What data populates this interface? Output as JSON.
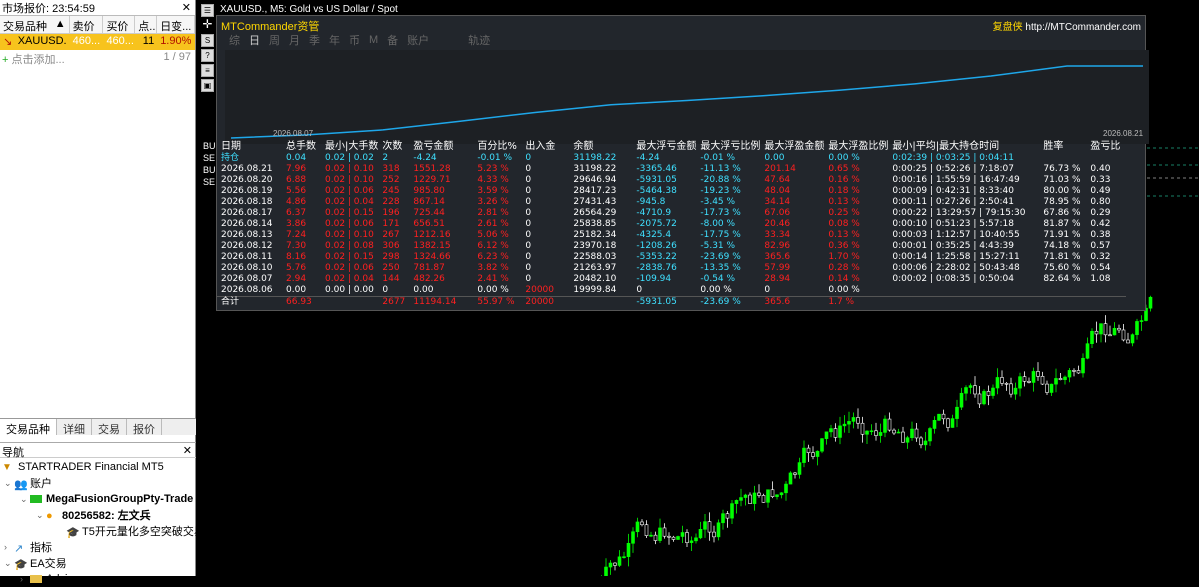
{
  "market_watch": {
    "title": "市场报价: 23:54:59",
    "columns": [
      "交易品种",
      "卖价",
      "买价",
      "点...",
      "日变..."
    ],
    "rows": [
      {
        "symbol": "XAUUSD.",
        "bid": "460...",
        "ask": "460...",
        "spread": "11",
        "change": "1.90%"
      }
    ],
    "add_label": "点击添加...",
    "count": "1 / 97",
    "tabs": [
      "交易品种",
      "详细",
      "交易",
      "报价"
    ]
  },
  "navigator": {
    "title": "导航",
    "items": [
      {
        "label": "STARTRADER Financial MT5",
        "level": 0
      },
      {
        "label": "账户",
        "level": 1
      },
      {
        "label": "MegaFusionGroupPty-Trade",
        "level": 2,
        "bold": true
      },
      {
        "label": "80256582: 左文兵",
        "level": 3,
        "bold": true
      },
      {
        "label": "T5开元量化多空突破交易系统",
        "level": 4
      },
      {
        "label": "指标",
        "level": 1
      },
      {
        "label": "EA交易",
        "level": 1
      },
      {
        "label": "Advisors",
        "level": 2
      }
    ]
  },
  "chart": {
    "title": "XAUUSD., M5:  Gold vs US Dollar / Spot",
    "colors": {
      "bull": "#00ff00",
      "bear": "#ffffff",
      "bg": "#000000"
    }
  },
  "toolbar_icons": [
    "menu-icon",
    "crosshair-icon",
    "script-icon",
    "info-icon",
    "list-icon",
    "save-icon"
  ],
  "buy_sell": [
    "BU",
    "SE",
    "BU",
    "SE"
  ],
  "mtc": {
    "title": "MTCommander资管",
    "brand": "复盘侠",
    "url": "http://MTCommander.com",
    "tabs": [
      "综",
      "日",
      "周",
      "月",
      "季",
      "年",
      "币",
      "M",
      "备",
      "账户",
      "轨迹"
    ],
    "active_tab": "日",
    "curve_start": "2026.08.07",
    "curve_end": "2026.08.21",
    "headers": [
      "日期",
      "总手数",
      "最小|大手数",
      "次数",
      "盈亏金额",
      "百分比%",
      "出入金",
      "余额",
      "最大浮亏金额",
      "最大浮亏比例",
      "最大浮盈金额",
      "最大浮盈比例",
      "最小|平均|最大持仓时间",
      "胜率",
      "盈亏比"
    ],
    "hold": [
      "持仓",
      "0.04",
      "0.02 | 0.02",
      "2",
      "-4.24",
      "-0.01 %",
      "0",
      "31198.22",
      "-4.24",
      "-0.01 %",
      "0.00",
      "0.00 %",
      "0:02:39 | 0:03:25 | 0:04:11",
      "",
      ""
    ],
    "rows": [
      [
        "2026.08.21",
        "7.96",
        "0.02 | 0.10",
        "318",
        "1551.28",
        "5.23 %",
        "0",
        "31198.22",
        "-3365.46",
        "-11.13 %",
        "201.14",
        "0.65 %",
        "0:00:25 | 0:52:26 | 7:18:07",
        "76.73 %",
        "0.40"
      ],
      [
        "2026.08.20",
        "6.88",
        "0.02 | 0.10",
        "252",
        "1229.71",
        "4.33 %",
        "0",
        "29646.94",
        "-5931.05",
        "-20.88 %",
        "47.64",
        "0.16 %",
        "0:00:16 | 1:55:59 | 16:47:49",
        "71.03 %",
        "0.33"
      ],
      [
        "2026.08.19",
        "5.56",
        "0.02 | 0.06",
        "245",
        "985.80",
        "3.59 %",
        "0",
        "28417.23",
        "-5464.38",
        "-19.23 %",
        "48.04",
        "0.18 %",
        "0:00:09 | 0:42:31 | 8:33:40",
        "80.00 %",
        "0.49"
      ],
      [
        "2026.08.18",
        "4.86",
        "0.02 | 0.04",
        "228",
        "867.14",
        "3.26 %",
        "0",
        "27431.43",
        "-945.8",
        "-3.45 %",
        "34.14",
        "0.13 %",
        "0:00:11 | 0:27:26 | 2:50:41",
        "78.95 %",
        "0.80"
      ],
      [
        "2026.08.17",
        "6.37",
        "0.02 | 0.15",
        "196",
        "725.44",
        "2.81 %",
        "0",
        "26564.29",
        "-4710.9",
        "-17.73 %",
        "67.06",
        "0.25 %",
        "0:00:22 | 13:29:57 | 79:15:30",
        "67.86 %",
        "0.29"
      ],
      [
        "2026.08.14",
        "3.86",
        "0.02 | 0.06",
        "171",
        "656.51",
        "2.61 %",
        "0",
        "25838.85",
        "-2075.72",
        "-8.00 %",
        "20.46",
        "0.08 %",
        "0:00:10 | 0:51:23 | 5:57:18",
        "81.87 %",
        "0.42"
      ],
      [
        "2026.08.13",
        "7.24",
        "0.02 | 0.10",
        "267",
        "1212.16",
        "5.06 %",
        "0",
        "25182.34",
        "-4325.4",
        "-17.75 %",
        "33.34",
        "0.13 %",
        "0:00:03 | 1:12:57 | 10:40:55",
        "71.91 %",
        "0.38"
      ],
      [
        "2026.08.12",
        "7.30",
        "0.02 | 0.08",
        "306",
        "1382.15",
        "6.12 %",
        "0",
        "23970.18",
        "-1208.26",
        "-5.31 %",
        "82.96",
        "0.36 %",
        "0:00:01 | 0:35:25 | 4:43:39",
        "74.18 %",
        "0.57"
      ],
      [
        "2026.08.11",
        "8.16",
        "0.02 | 0.15",
        "298",
        "1324.66",
        "6.23 %",
        "0",
        "22588.03",
        "-5353.22",
        "-23.69 %",
        "365.6",
        "1.70 %",
        "0:00:14 | 1:25:58 | 15:27:11",
        "71.81 %",
        "0.32"
      ],
      [
        "2026.08.10",
        "5.76",
        "0.02 | 0.06",
        "250",
        "781.87",
        "3.82 %",
        "0",
        "21263.97",
        "-2838.76",
        "-13.35 %",
        "57.99",
        "0.28 %",
        "0:00:06 | 2:28:02 | 50:43:48",
        "75.60 %",
        "0.54"
      ],
      [
        "2026.08.07",
        "2.94",
        "0.02 | 0.04",
        "144",
        "482.26",
        "2.41 %",
        "0",
        "20482.10",
        "-109.94",
        "-0.54 %",
        "28.94",
        "0.14 %",
        "0:00:02 | 0:08:35 | 0:50:04",
        "82.64 %",
        "1.08"
      ],
      [
        "2026.08.06",
        "0.00",
        "0.00 | 0.00",
        "0",
        "0.00",
        "0.00 %",
        "20000",
        "19999.84",
        "0",
        "0.00 %",
        "0",
        "0.00 %",
        "",
        "",
        ""
      ]
    ],
    "total": [
      "合计",
      "66.93",
      "",
      "2677",
      "11194.14",
      "55.97 %",
      "20000",
      "",
      "-5931.05",
      "-23.69 %",
      "365.6",
      "1.7 %",
      "",
      "",
      ""
    ]
  }
}
